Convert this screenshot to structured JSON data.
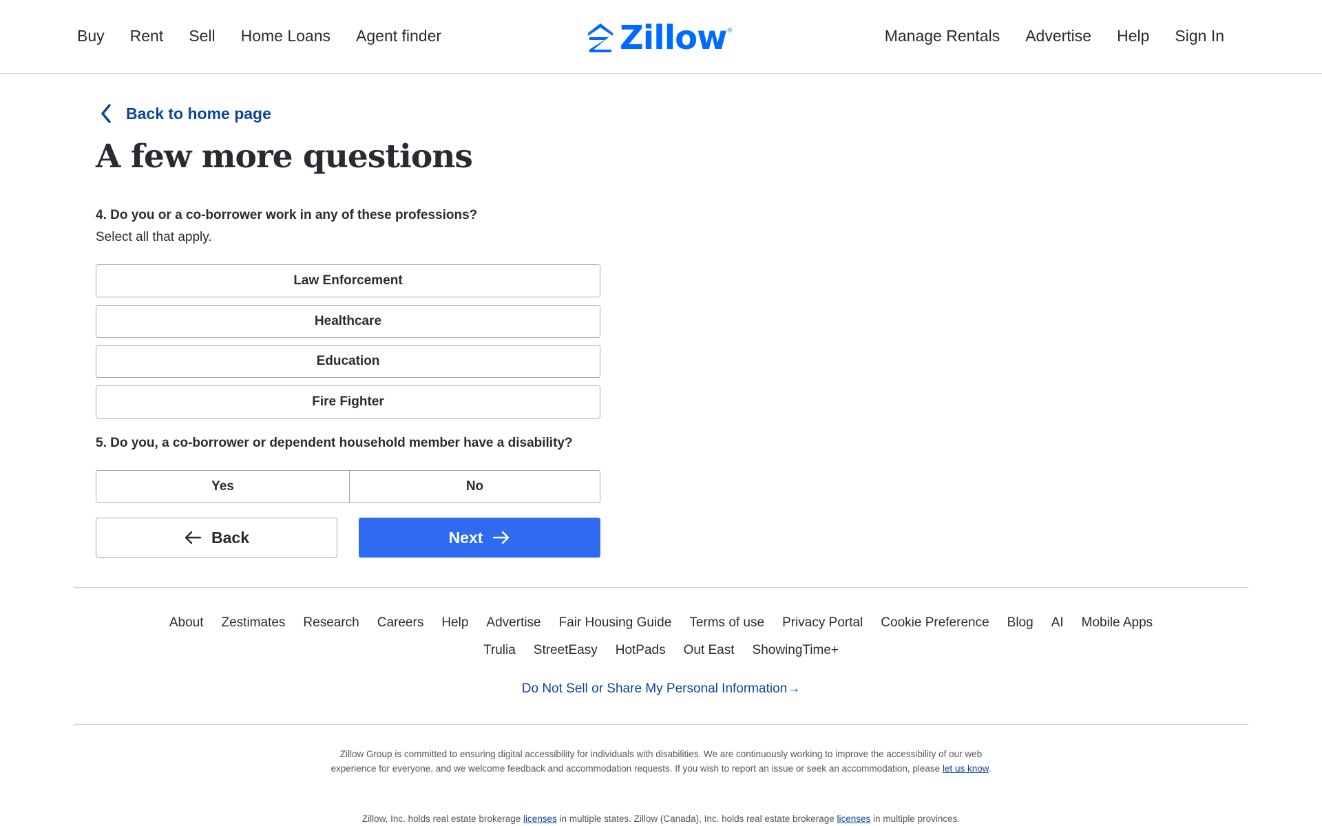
{
  "header": {
    "nav_left": [
      "Buy",
      "Rent",
      "Sell",
      "Home Loans",
      "Agent finder"
    ],
    "nav_right": [
      "Manage Rentals",
      "Advertise",
      "Help",
      "Sign In"
    ],
    "logo_text": "Zillow",
    "logo_reg": "®",
    "brand_color": "#006aff"
  },
  "main": {
    "back_link": "Back to home page",
    "title": "A few more questions",
    "q4": {
      "label": "4. Do you or a co-borrower work in any of these professions?",
      "sub": "Select all that apply.",
      "options": [
        "Law Enforcement",
        "Healthcare",
        "Education",
        "Fire Fighter"
      ]
    },
    "q5": {
      "label": "5. Do you, a co-borrower or dependent household member have a disability?",
      "yes": "Yes",
      "no": "No"
    },
    "back_button": "Back",
    "next_button": "Next",
    "next_color": "#2e6bf0"
  },
  "footer": {
    "links_row1": [
      "About",
      "Zestimates",
      "Research",
      "Careers",
      "Help",
      "Advertise",
      "Fair Housing Guide",
      "Terms of use",
      "Privacy Portal",
      "Cookie Preference",
      "Blog",
      "AI",
      "Mobile Apps"
    ],
    "links_row2": [
      "Trulia",
      "StreetEasy",
      "HotPads",
      "Out East",
      "ShowingTime+"
    ],
    "do_not_sell": "Do Not Sell or Share My Personal Information→",
    "a11y_text": "Zillow Group is committed to ensuring digital accessibility for individuals with disabilities. We are continuously working to improve the accessibility of our web experience for everyone, and we welcome feedback and accommodation requests. If you wish to report an issue or seek an accommodation, please",
    "a11y_link": "let us know",
    "a11y_end": ".",
    "legal_1": "Zillow, Inc. holds real estate brokerage",
    "legal_link_1": "licenses",
    "legal_2": "in multiple states. Zillow (Canada), Inc. holds real estate brokerage",
    "legal_link_2": "licenses",
    "legal_3": "in multiple provinces."
  }
}
